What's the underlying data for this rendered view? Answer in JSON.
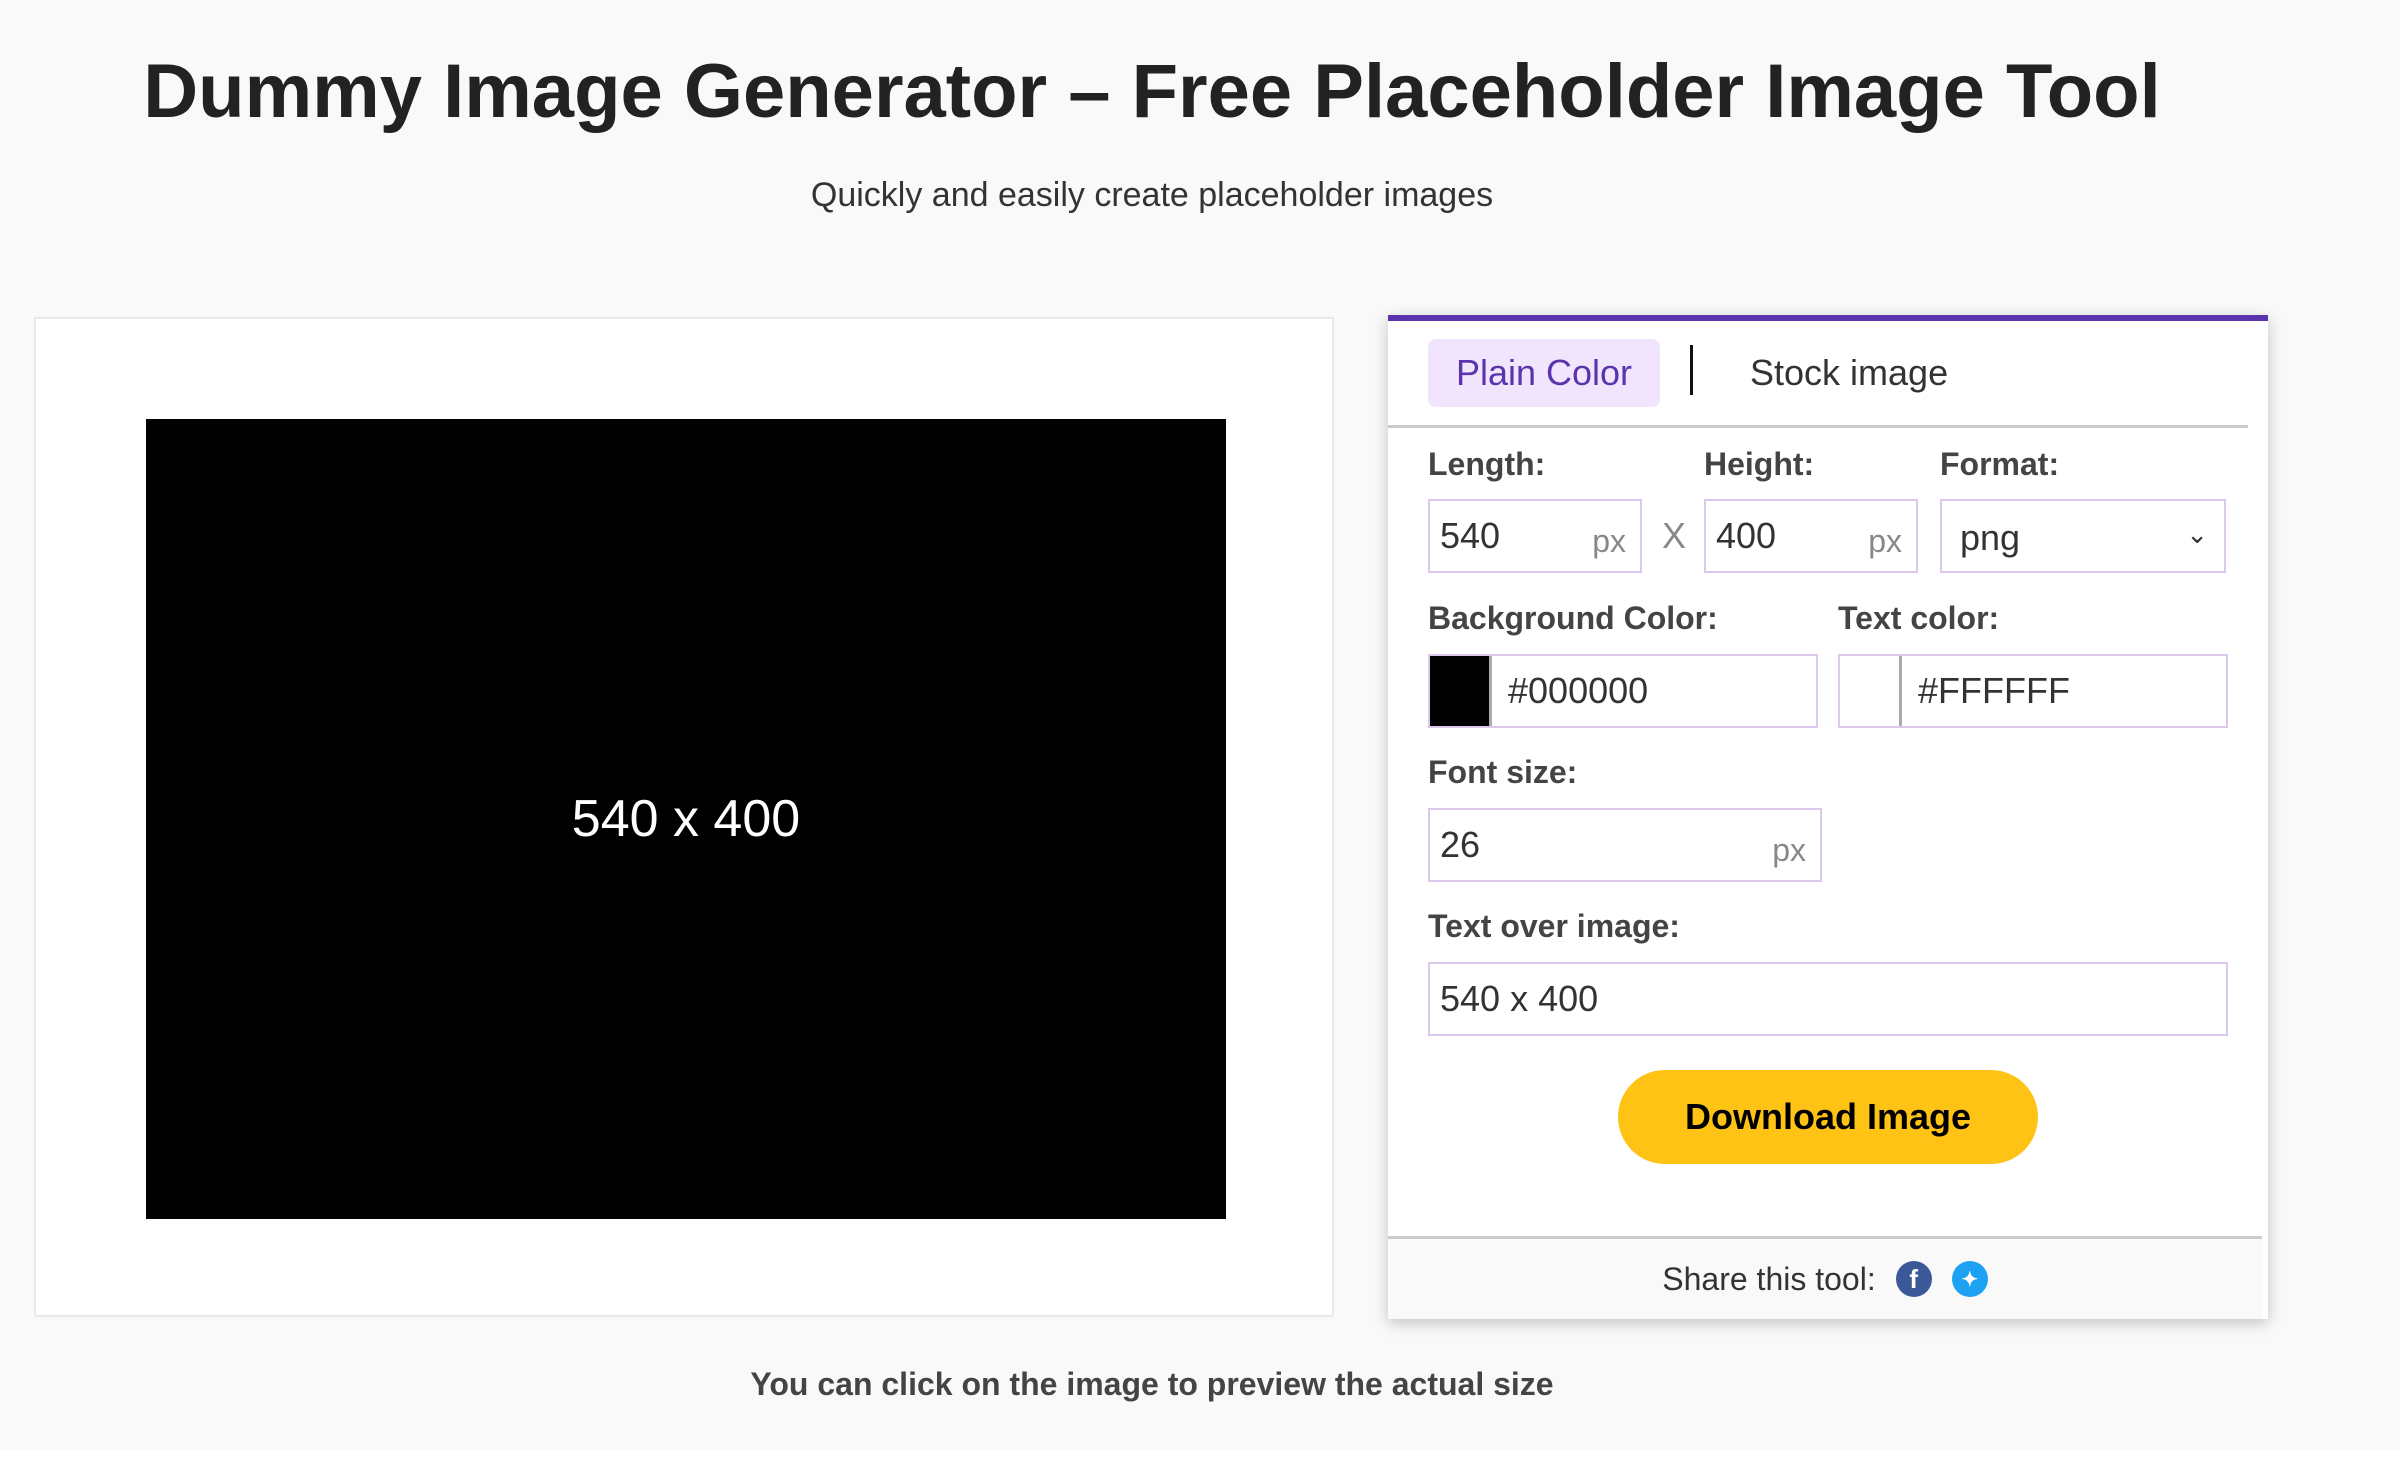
{
  "header": {
    "title": "Dummy Image Generator – Free Placeholder Image Tool",
    "subtitle": "Quickly and easily create placeholder images"
  },
  "preview": {
    "image_text": "540 x 400",
    "background_color": "#000000",
    "text_color": "#FFFFFF",
    "note": "You can click on the image to preview the actual size"
  },
  "panel": {
    "accent_color": "#5b34ad",
    "tabs": [
      {
        "label": "Plain Color",
        "active": true
      },
      {
        "label": "Stock image",
        "active": false
      }
    ],
    "length": {
      "label": "Length:",
      "value": "540",
      "unit": "px"
    },
    "times": "X",
    "height": {
      "label": "Height:",
      "value": "400",
      "unit": "px"
    },
    "format": {
      "label": "Format:",
      "value": "png"
    },
    "background_color": {
      "label": "Background Color:",
      "value": "#000000"
    },
    "text_color": {
      "label": "Text color:",
      "value": "#FFFFFF"
    },
    "font_size": {
      "label": "Font size:",
      "value": "26",
      "unit": "px"
    },
    "text_over_image": {
      "label": "Text over image:",
      "value": "540 x 400"
    },
    "download_label": "Download Image",
    "download_color": "#fec314",
    "share": {
      "label": "Share this tool:",
      "icons": [
        "facebook-icon",
        "twitter-icon"
      ]
    }
  }
}
